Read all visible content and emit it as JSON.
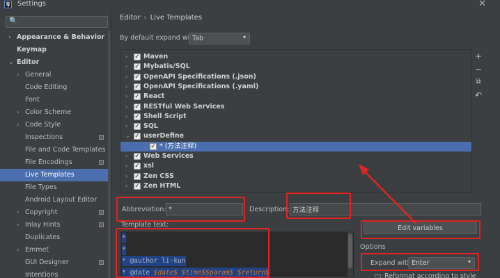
{
  "window": {
    "app_icon_letter": "IJ",
    "title": "Settings",
    "close_glyph": "✕"
  },
  "sidebar": {
    "search_placeholder": "",
    "search_icon_glyph": "🔍",
    "items": [
      {
        "label": "Appearance & Behavior",
        "level": 0,
        "arrow": "›",
        "bold": true
      },
      {
        "label": "Keymap",
        "level": 0,
        "arrow": "",
        "bold": true
      },
      {
        "label": "Editor",
        "level": 0,
        "arrow": "⌄",
        "bold": true
      },
      {
        "label": "General",
        "level": 1,
        "arrow": "›"
      },
      {
        "label": "Code Editing",
        "level": 1,
        "arrow": ""
      },
      {
        "label": "Font",
        "level": 1,
        "arrow": ""
      },
      {
        "label": "Color Scheme",
        "level": 1,
        "arrow": "›"
      },
      {
        "label": "Code Style",
        "level": 1,
        "arrow": "›"
      },
      {
        "label": "Inspections",
        "level": 1,
        "arrow": "",
        "badge": true
      },
      {
        "label": "File and Code Templates",
        "level": 1,
        "arrow": ""
      },
      {
        "label": "File Encodings",
        "level": 1,
        "arrow": "",
        "badge": true
      },
      {
        "label": "Live Templates",
        "level": 1,
        "arrow": "",
        "selected": true
      },
      {
        "label": "File Types",
        "level": 1,
        "arrow": ""
      },
      {
        "label": "Android Layout Editor",
        "level": 1,
        "arrow": ""
      },
      {
        "label": "Copyright",
        "level": 1,
        "arrow": "›",
        "badge": true
      },
      {
        "label": "Inlay Hints",
        "level": 1,
        "arrow": "›",
        "badge": true
      },
      {
        "label": "Duplicates",
        "level": 1,
        "arrow": ""
      },
      {
        "label": "Emmet",
        "level": 1,
        "arrow": "›"
      },
      {
        "label": "GUI Designer",
        "level": 1,
        "arrow": "",
        "badge": true
      },
      {
        "label": "Intentions",
        "level": 1,
        "arrow": ""
      }
    ]
  },
  "main": {
    "breadcrumb": {
      "parent": "Editor",
      "separator": "›",
      "current": "Live Templates"
    },
    "expand_by_default": {
      "label": "By default expand with",
      "value": "Tab",
      "caret": "▾"
    },
    "templates": [
      {
        "label": "Maven",
        "arrow": "›",
        "checked": true
      },
      {
        "label": "Mybatis/SQL",
        "arrow": "›",
        "checked": true
      },
      {
        "label": "OpenAPI Specifications (.json)",
        "arrow": "›",
        "checked": true
      },
      {
        "label": "OpenAPI Specifications (.yaml)",
        "arrow": "›",
        "checked": true
      },
      {
        "label": "React",
        "arrow": "›",
        "checked": true
      },
      {
        "label": "RESTful Web Services",
        "arrow": "›",
        "checked": true
      },
      {
        "label": "Shell Script",
        "arrow": "›",
        "checked": true
      },
      {
        "label": "SQL",
        "arrow": "›",
        "checked": true
      },
      {
        "label": "userDefine",
        "arrow": "⌄",
        "checked": true
      },
      {
        "label": "* (方法注释)",
        "arrow": "",
        "checked": true,
        "child": true,
        "selected": true
      },
      {
        "label": "Web Services",
        "arrow": "›",
        "checked": true
      },
      {
        "label": "xsl",
        "arrow": "›",
        "checked": true
      },
      {
        "label": "Zen CSS",
        "arrow": "›",
        "checked": true
      },
      {
        "label": "Zen HTML",
        "arrow": "›",
        "checked": true
      }
    ],
    "check_glyph": "✓",
    "tools": {
      "add": "+",
      "remove": "−",
      "copy": "⧉",
      "revert": "↶"
    },
    "abbreviation": {
      "label": "Abbreviation:",
      "value": "*"
    },
    "description": {
      "label": "Description:",
      "value": "方法注释"
    },
    "template_text": {
      "label": "Template text:",
      "lines": [
        [
          {
            "t": "*"
          }
        ],
        [
          {
            "t": "*"
          }
        ],
        [
          {
            "t": "* @author li-kun"
          }
        ],
        [
          {
            "t": "* @date "
          },
          {
            "t": "$date$",
            "var": true
          },
          {
            "t": " "
          },
          {
            "t": "$time$",
            "var": true
          },
          {
            "t": "$param$",
            "var": true
          },
          {
            "t": " "
          },
          {
            "t": "$return$",
            "var": true
          }
        ]
      ]
    },
    "edit_variables": "Edit variables",
    "options": {
      "label": "Options",
      "expand_with_label": "Expand with",
      "expand_with_value": "Enter",
      "caret": "▾",
      "reformat_label": "Reformat according to style"
    }
  }
}
